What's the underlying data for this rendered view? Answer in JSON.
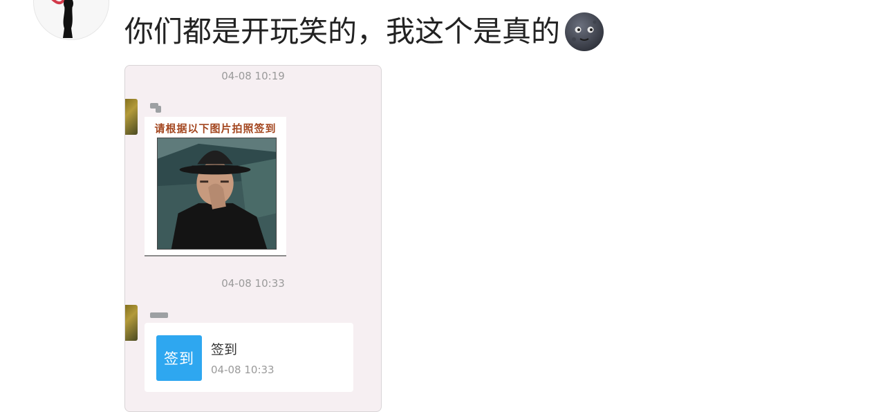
{
  "post": {
    "text": "你们都是开玩笑的，我这个是真的",
    "emoji": "new-moon-face-emoji"
  },
  "chat": {
    "messages": [
      {
        "timestamp": "04-08 10:19",
        "type": "image",
        "caption": "请根据以下图片拍照签到"
      },
      {
        "timestamp": "04-08 10:33",
        "type": "checkin",
        "icon_label": "签到",
        "title": "签到",
        "time": "04-08 10:33"
      }
    ]
  },
  "colors": {
    "chat_bg": "#f6eff2",
    "checkin_blue": "#2ea7f0",
    "caption_orange": "#a3461f"
  }
}
